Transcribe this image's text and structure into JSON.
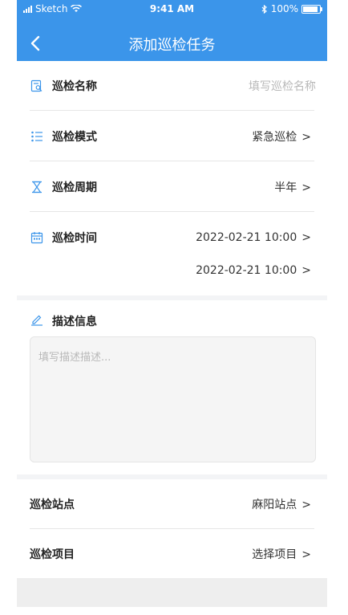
{
  "status_bar": {
    "carrier": "Sketch",
    "time": "9:41 AM",
    "battery": "100%"
  },
  "nav": {
    "title": "添加巡检任务"
  },
  "form": {
    "name": {
      "label": "巡检名称",
      "placeholder": "填写巡检名称"
    },
    "mode": {
      "label": "巡检模式",
      "value": "紧急巡检"
    },
    "period": {
      "label": "巡检周期",
      "value": "半年"
    },
    "time": {
      "label": "巡检时间",
      "start": "2022-02-21 10:00",
      "end": "2022-02-21 10:00"
    },
    "description": {
      "label": "描述信息",
      "placeholder": "填写描述描述..."
    },
    "station": {
      "label": "巡检站点",
      "value": "麻阳站点"
    },
    "project": {
      "label": "巡检项目",
      "value": "选择项目"
    }
  },
  "chevron": ">",
  "colors": {
    "header_bg": "#3b95ea",
    "icon_blue": "#3b95ea",
    "separator": "#f3f4f6"
  }
}
